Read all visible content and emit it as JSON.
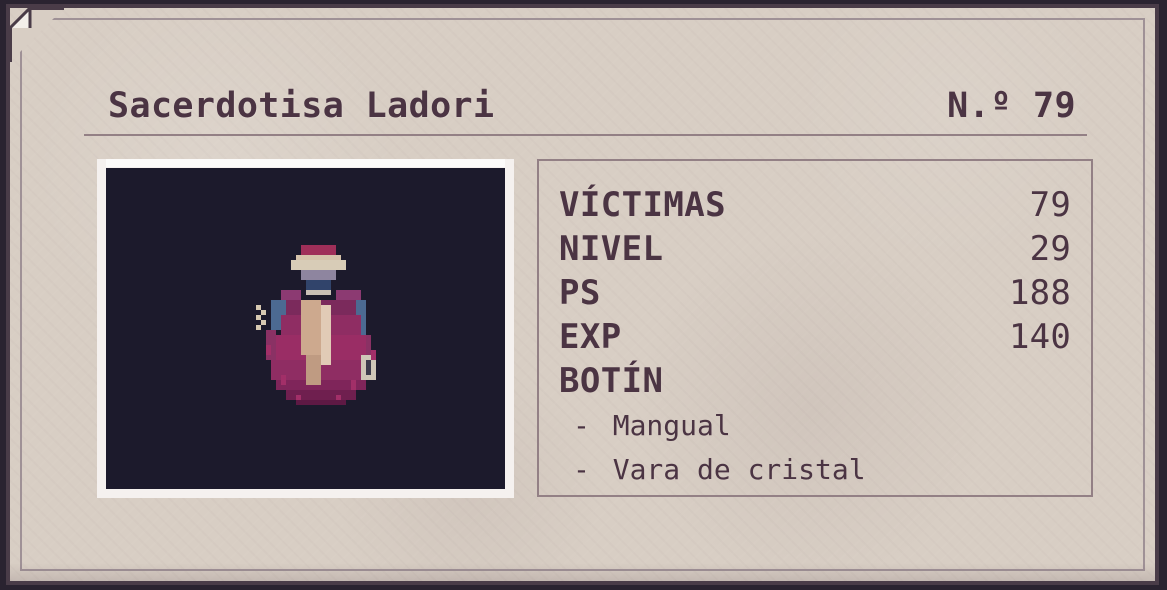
{
  "card": {
    "title": "Sacerdotisa Ladori",
    "number": "N.º 79"
  },
  "portrait": {
    "icon": "priestess-sprite-icon"
  },
  "stats": {
    "items": [
      {
        "label": "VÍCTIMAS",
        "value": "79"
      },
      {
        "label": "NIVEL",
        "value": "29"
      },
      {
        "label": "PS",
        "value": "188"
      },
      {
        "label": "EXP",
        "value": "140"
      },
      {
        "label": "BOTÍN",
        "value": ""
      }
    ],
    "loot": [
      "Mangual",
      "Vara de cristal"
    ]
  },
  "colors": {
    "paper": "#d8cec4",
    "border": "#4a3c48",
    "text": "#4b3443",
    "panel_line": "#938085",
    "portrait_bg": "#1c1a2c",
    "robe": "#8f2d63"
  }
}
